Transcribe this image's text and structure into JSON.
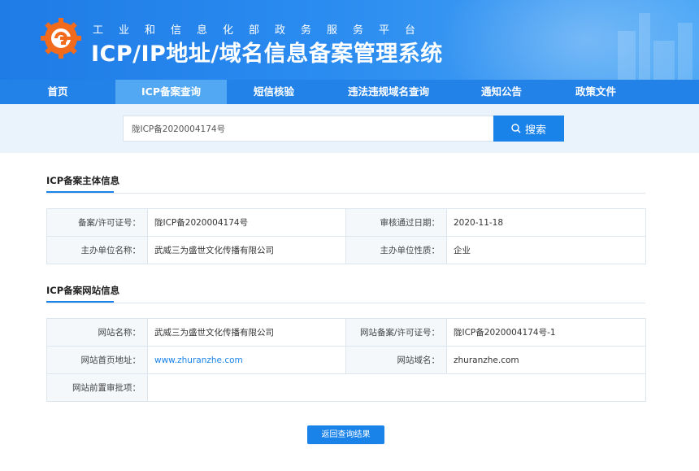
{
  "header": {
    "subtitle": "工业和信息化部政务服务平台",
    "title": "ICP/IP地址/域名信息备案管理系统"
  },
  "nav": {
    "items": [
      {
        "label": "首页"
      },
      {
        "label": "ICP备案查询"
      },
      {
        "label": "短信核验"
      },
      {
        "label": "违法违规域名查询"
      },
      {
        "label": "通知公告"
      },
      {
        "label": "政策文件"
      }
    ],
    "active_index": 1
  },
  "search": {
    "value": "陇ICP备2020004174号",
    "button_label": "搜索"
  },
  "subject_section": {
    "title": "ICP备案主体信息",
    "rows": [
      {
        "label1": "备案/许可证号：",
        "value1": "陇ICP备2020004174号",
        "label2": "审核通过日期：",
        "value2": "2020-11-18"
      },
      {
        "label1": "主办单位名称：",
        "value1": "武威三为盛世文化传播有限公司",
        "label2": "主办单位性质：",
        "value2": "企业"
      }
    ]
  },
  "website_section": {
    "title": "ICP备案网站信息",
    "rows": [
      {
        "label1": "网站名称：",
        "value1": "武威三为盛世文化传播有限公司",
        "label2": "网站备案/许可证号：",
        "value2": "陇ICP备2020004174号-1"
      },
      {
        "label1": "网站首页地址：",
        "value1": "www.zhuranzhe.com",
        "label2": "网站域名：",
        "value2": "zhuranzhe.com"
      }
    ],
    "approval_label": "网站前置审批项：",
    "approval_value": ""
  },
  "back_button_label": "返回查询结果",
  "colors": {
    "primary": "#1a83ea",
    "nav_bg": "#2382e8",
    "nav_active": "#52a8f2",
    "logo_orange": "#f26b1d"
  }
}
